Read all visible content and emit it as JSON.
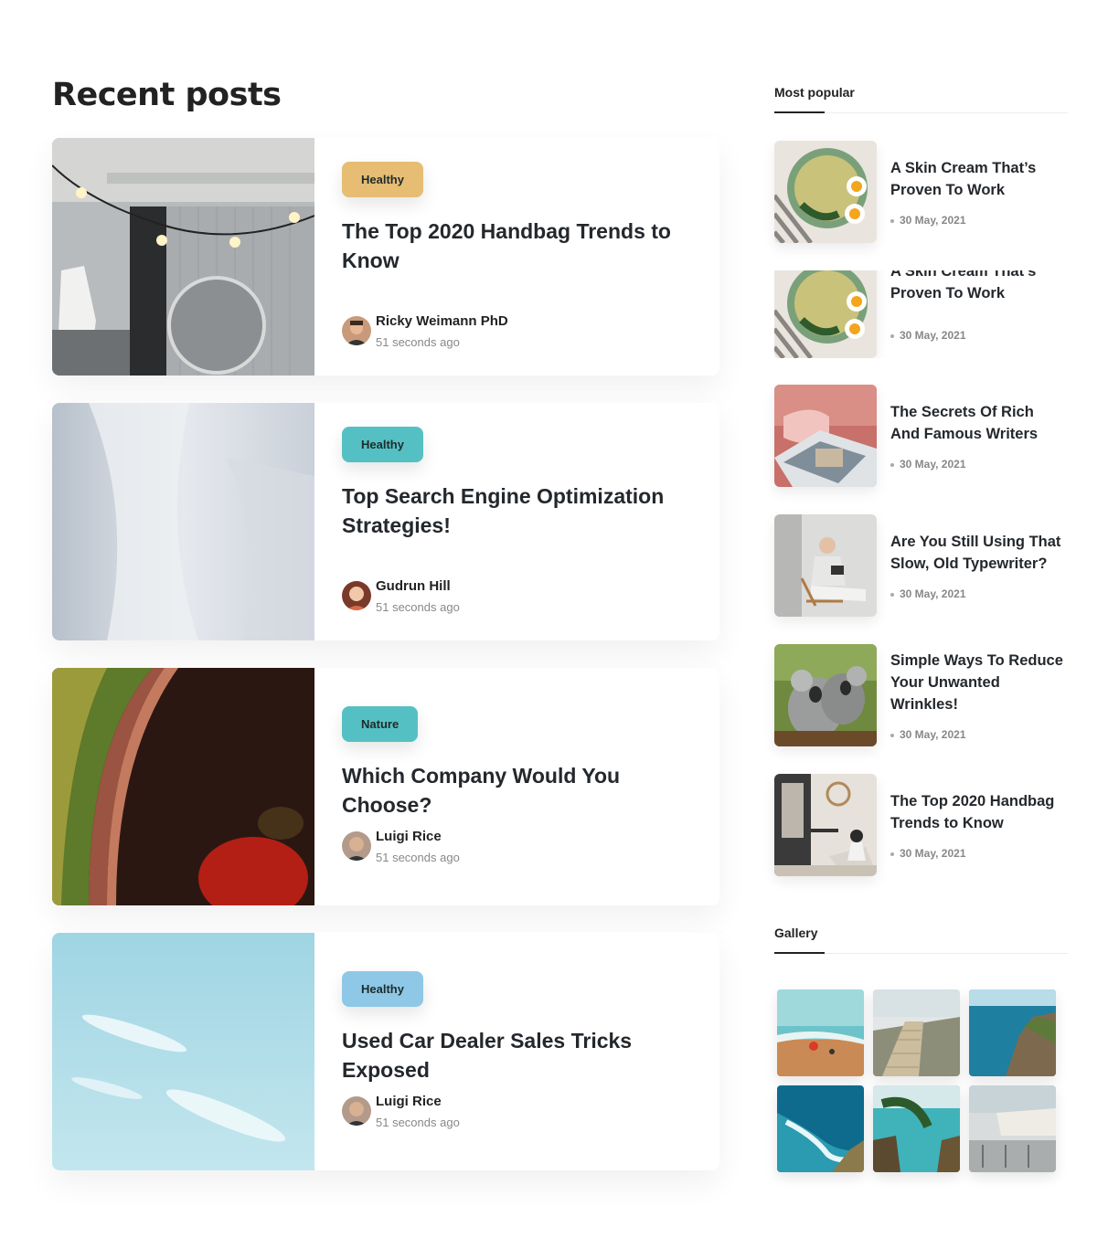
{
  "main": {
    "section_title": "Recent posts",
    "posts": [
      {
        "tag": "Healthy",
        "tag_color": "#e6bd73",
        "title": "The Top 2020 Handbag Trends to Know",
        "author": "Ricky Weimann PhD",
        "time": "51 seconds ago",
        "image": "interior-photo"
      },
      {
        "tag": "Healthy",
        "tag_color": "#55c0c4",
        "title": "Top Search Engine Optimization Strategies!",
        "author": "Gudrun Hill",
        "time": "51 seconds ago",
        "image": "fabric-photo"
      },
      {
        "tag": "Nature",
        "tag_color": "#55c0c4",
        "title": "Which Company Would You Choose?",
        "author": "Luigi Rice",
        "time": "51 seconds ago",
        "image": "bowl-photo"
      },
      {
        "tag": "Healthy",
        "tag_color": "#8ec8e6",
        "title": "Used Car Dealer Sales Tricks Exposed",
        "author": "Luigi Rice",
        "time": "51 seconds ago",
        "image": "sky-photo"
      }
    ]
  },
  "sidebar": {
    "most_popular_title": "Most popular",
    "popular": [
      {
        "title": "A Skin Cream That’s Proven To Work",
        "date": "30 May, 2021",
        "image": "salad-photo"
      },
      {
        "title": "A Skin Cream That’s Proven To Work",
        "date": "30 May, 2021",
        "image": "salad-photo"
      },
      {
        "title": "The Secrets Of Rich And Famous Writers",
        "date": "30 May, 2021",
        "image": "magazine-photo"
      },
      {
        "title": "Are You Still Using That Slow, Old Typewriter?",
        "date": "30 May, 2021",
        "image": "reading-man-photo"
      },
      {
        "title": "Simple Ways To Reduce Your Unwanted Wrinkles!",
        "date": "30 May, 2021",
        "image": "koala-photo"
      },
      {
        "title": "The Top 2020 Handbag Trends to Know",
        "date": "30 May, 2021",
        "image": "woman-room-photo"
      }
    ],
    "gallery_title": "Gallery",
    "gallery": [
      "beach-photo",
      "boardwalk-photo",
      "coast-photo",
      "waves-photo",
      "cove-photo",
      "terrace-photo"
    ]
  }
}
